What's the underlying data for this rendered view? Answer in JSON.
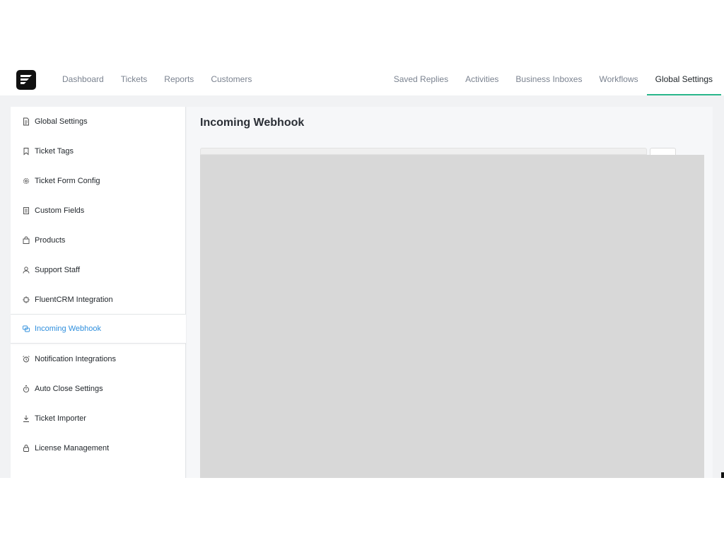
{
  "topnav": {
    "left": [
      "Dashboard",
      "Tickets",
      "Reports",
      "Customers"
    ],
    "right": [
      "Saved Replies",
      "Activities",
      "Business Inboxes",
      "Workflows",
      "Global Settings"
    ],
    "active": "Global Settings",
    "accent_color": "#2ab78b"
  },
  "sidebar": {
    "items": [
      {
        "label": "Global Settings",
        "icon": "document-icon"
      },
      {
        "label": "Ticket Tags",
        "icon": "bookmark-icon"
      },
      {
        "label": "Ticket Form Config",
        "icon": "gear-icon"
      },
      {
        "label": "Custom Fields",
        "icon": "list-document-icon"
      },
      {
        "label": "Products",
        "icon": "shopping-bag-icon"
      },
      {
        "label": "Support Staff",
        "icon": "user-icon"
      },
      {
        "label": "FluentCRM Integration",
        "icon": "chip-icon"
      },
      {
        "label": "Incoming Webhook",
        "icon": "webhook-icon"
      },
      {
        "label": "Notification Integrations",
        "icon": "alarm-icon"
      },
      {
        "label": "Auto Close Settings",
        "icon": "stopwatch-icon"
      },
      {
        "label": "Ticket Importer",
        "icon": "download-icon"
      },
      {
        "label": "License Management",
        "icon": "lock-icon"
      }
    ],
    "active_index": 7,
    "active_color": "#2f8fdd"
  },
  "content": {
    "title": "Incoming Webhook"
  }
}
